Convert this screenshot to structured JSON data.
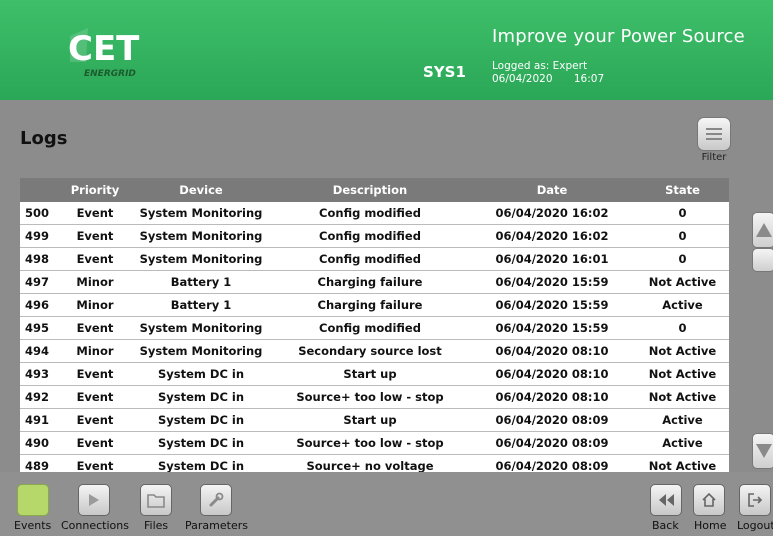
{
  "header": {
    "brand_top": "CET",
    "brand_bottom": "ENERGRID",
    "tagline": "Improve your Power Source",
    "system": "SYS1",
    "logged_as": "Logged as: Expert",
    "date": "06/04/2020",
    "time": "16:07"
  },
  "page": {
    "title": "Logs",
    "filter_label": "Filter"
  },
  "table": {
    "columns": [
      "",
      "Priority",
      "Device",
      "Description",
      "Date",
      "State"
    ],
    "rows": [
      [
        "500",
        "Event",
        "System Monitoring",
        "Config modified",
        "06/04/2020 16:02",
        "0"
      ],
      [
        "499",
        "Event",
        "System Monitoring",
        "Config modified",
        "06/04/2020 16:02",
        "0"
      ],
      [
        "498",
        "Event",
        "System Monitoring",
        "Config modified",
        "06/04/2020 16:01",
        "0"
      ],
      [
        "497",
        "Minor",
        "Battery 1",
        "Charging failure",
        "06/04/2020 15:59",
        "Not Active"
      ],
      [
        "496",
        "Minor",
        "Battery 1",
        "Charging failure",
        "06/04/2020 15:59",
        "Active"
      ],
      [
        "495",
        "Event",
        "System Monitoring",
        "Config modified",
        "06/04/2020 15:59",
        "0"
      ],
      [
        "494",
        "Minor",
        "System Monitoring",
        "Secondary source lost",
        "06/04/2020 08:10",
        "Not Active"
      ],
      [
        "493",
        "Event",
        "System DC in",
        "Start up",
        "06/04/2020 08:10",
        "Not Active"
      ],
      [
        "492",
        "Event",
        "System DC in",
        "Source+ too low - stop",
        "06/04/2020 08:10",
        "Not Active"
      ],
      [
        "491",
        "Event",
        "System DC in",
        "Start up",
        "06/04/2020 08:09",
        "Active"
      ],
      [
        "490",
        "Event",
        "System DC in",
        "Source+ too low - stop",
        "06/04/2020 08:09",
        "Active"
      ],
      [
        "489",
        "Event",
        "System DC in",
        "Source+ no voltage",
        "06/04/2020 08:09",
        "Not Active"
      ]
    ]
  },
  "nav": {
    "events": "Events",
    "connections": "Connections",
    "files": "Files",
    "parameters": "Parameters",
    "back": "Back",
    "home": "Home",
    "logout": "Logout"
  },
  "colors": {
    "header_green": "#33b363",
    "events_active": "#b6d86a"
  },
  "icons": {
    "filter": "filter-list-icon",
    "scroll_up": "triangle-up-icon",
    "scroll_down": "triangle-down-icon",
    "connections": "arrow-right-icon",
    "files": "folder-icon",
    "parameters": "wrench-icon",
    "back": "double-left-arrow-icon",
    "home": "home-icon",
    "logout": "logout-icon"
  }
}
